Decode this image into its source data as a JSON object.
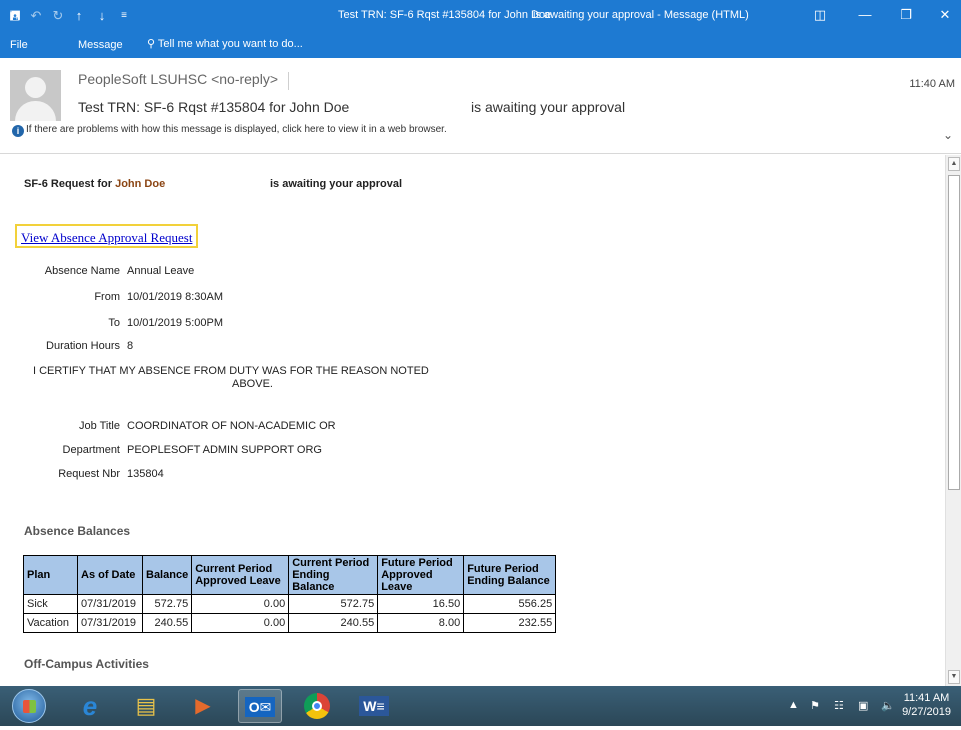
{
  "window": {
    "title_left": "Test TRN: SF-6 Rqst #135804 for John Doe",
    "title_right": "is awaiting your approval - Message (HTML)"
  },
  "ribbon": {
    "tabs": [
      "File",
      "Message"
    ],
    "tell_me": "Tell me what you want to do..."
  },
  "header": {
    "sender": "PeopleSoft LSUHSC <no-reply>",
    "time": "11:40 AM",
    "subject_left": "Test TRN: SF-6 Rqst #135804 for  John Doe",
    "subject_right": "is awaiting your approval",
    "info_bar": "If there are problems with how this message is displayed, click here to view it in a web browser."
  },
  "message": {
    "heading_prefix": "SF-6 Request for",
    "heading_name": "John Doe",
    "heading_suffix": "is awaiting your approval",
    "link": "View Absence Approval Request",
    "fields": [
      {
        "label": "Absence Name",
        "value": "Annual Leave"
      },
      {
        "label": "From",
        "value": "10/01/2019 8:30AM"
      },
      {
        "label": "To",
        "value": "10/01/2019 5:00PM"
      },
      {
        "label": "Duration Hours",
        "value": "8"
      }
    ],
    "certify_line1": "I CERTIFY THAT MY ABSENCE FROM DUTY WAS FOR THE REASON NOTED",
    "certify_line2": "ABOVE.",
    "fields2": [
      {
        "label": "Job Title",
        "value": "COORDINATOR OF NON-ACADEMIC OR"
      },
      {
        "label": "Department",
        "value": "PEOPLESOFT ADMIN SUPPORT ORG"
      },
      {
        "label": "Request Nbr",
        "value": "135804"
      }
    ],
    "balances_title": "Absence Balances",
    "balances_headers": [
      "Plan",
      "As of Date",
      "Balance",
      "Current Period Approved Leave",
      "Current Period Ending Balance",
      "Future Period Approved Leave",
      "Future Period Ending Balance"
    ],
    "balances_rows": [
      [
        "Sick",
        "07/31/2019",
        "572.75",
        "0.00",
        "572.75",
        "16.50",
        "556.25"
      ],
      [
        "Vacation",
        "07/31/2019",
        "240.55",
        "0.00",
        "240.55",
        "8.00",
        "232.55"
      ]
    ],
    "offcampus_title": "Off-Campus Activities"
  },
  "taskbar": {
    "time": "11:41 AM",
    "date": "9/27/2019"
  }
}
